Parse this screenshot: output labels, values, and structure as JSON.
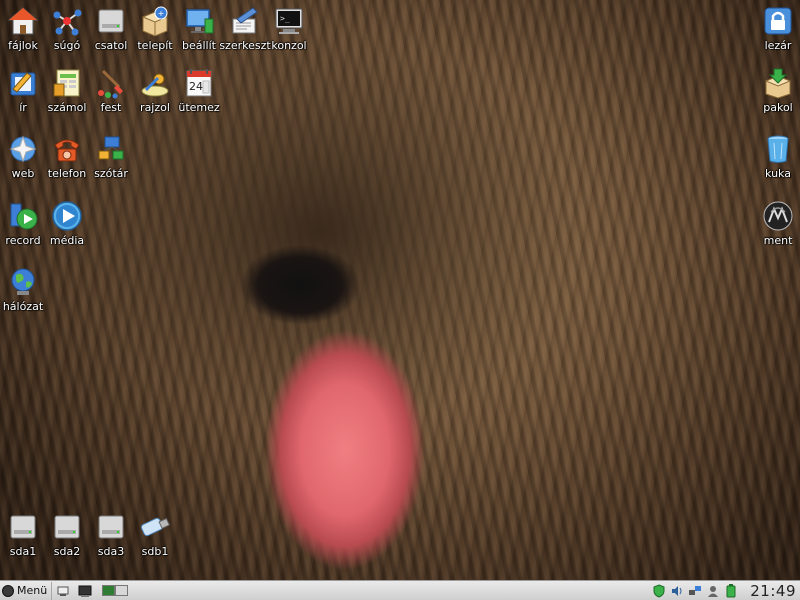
{
  "desktop_icons": {
    "fajlok": {
      "label": "fájlok",
      "icon": "home-folder-icon"
    },
    "sugo": {
      "label": "súgó",
      "icon": "help-network-icon"
    },
    "csatol": {
      "label": "csatol",
      "icon": "drive-mount-icon"
    },
    "telepit": {
      "label": "telepít",
      "icon": "package-install-icon"
    },
    "beallit": {
      "label": "beállít",
      "icon": "settings-monitor-icon"
    },
    "szerkeszt": {
      "label": "szerkeszt",
      "icon": "text-editor-icon"
    },
    "konzol": {
      "label": "konzol",
      "icon": "terminal-icon"
    },
    "ir": {
      "label": "ír",
      "icon": "writer-icon"
    },
    "szamol": {
      "label": "számol",
      "icon": "spreadsheet-icon"
    },
    "fest": {
      "label": "fest",
      "icon": "paint-icon"
    },
    "rajzol": {
      "label": "rajzol",
      "icon": "draw-icon"
    },
    "utemez": {
      "label": "ütemez",
      "icon": "calendar-icon",
      "day": "24"
    },
    "web": {
      "label": "web",
      "icon": "web-browser-icon"
    },
    "telefon": {
      "label": "telefon",
      "icon": "phone-icon"
    },
    "szotar": {
      "label": "szótár",
      "icon": "dictionary-icon"
    },
    "record": {
      "label": "record",
      "icon": "record-icon"
    },
    "media": {
      "label": "média",
      "icon": "media-player-icon"
    },
    "halozat": {
      "label": "hálózat",
      "icon": "network-globe-icon"
    },
    "lezar": {
      "label": "lezár",
      "icon": "lock-icon"
    },
    "pakol": {
      "label": "pakol",
      "icon": "archive-icon"
    },
    "kuka": {
      "label": "kuka",
      "icon": "trash-icon"
    },
    "ment": {
      "label": "ment",
      "icon": "backup-icon"
    },
    "sda1": {
      "label": "sda1",
      "icon": "hard-drive-icon"
    },
    "sda2": {
      "label": "sda2",
      "icon": "hard-drive-icon"
    },
    "sda3": {
      "label": "sda3",
      "icon": "hard-drive-icon"
    },
    "sdb1": {
      "label": "sdb1",
      "icon": "usb-drive-icon"
    }
  },
  "taskbar": {
    "menu_label": "Menü",
    "clock": "21:49",
    "active_workspace": 1
  },
  "colors": {
    "taskbar_bg": "#dcdcdc",
    "icon_label": "#ffffff",
    "workspace_active": "#2e7d32"
  }
}
